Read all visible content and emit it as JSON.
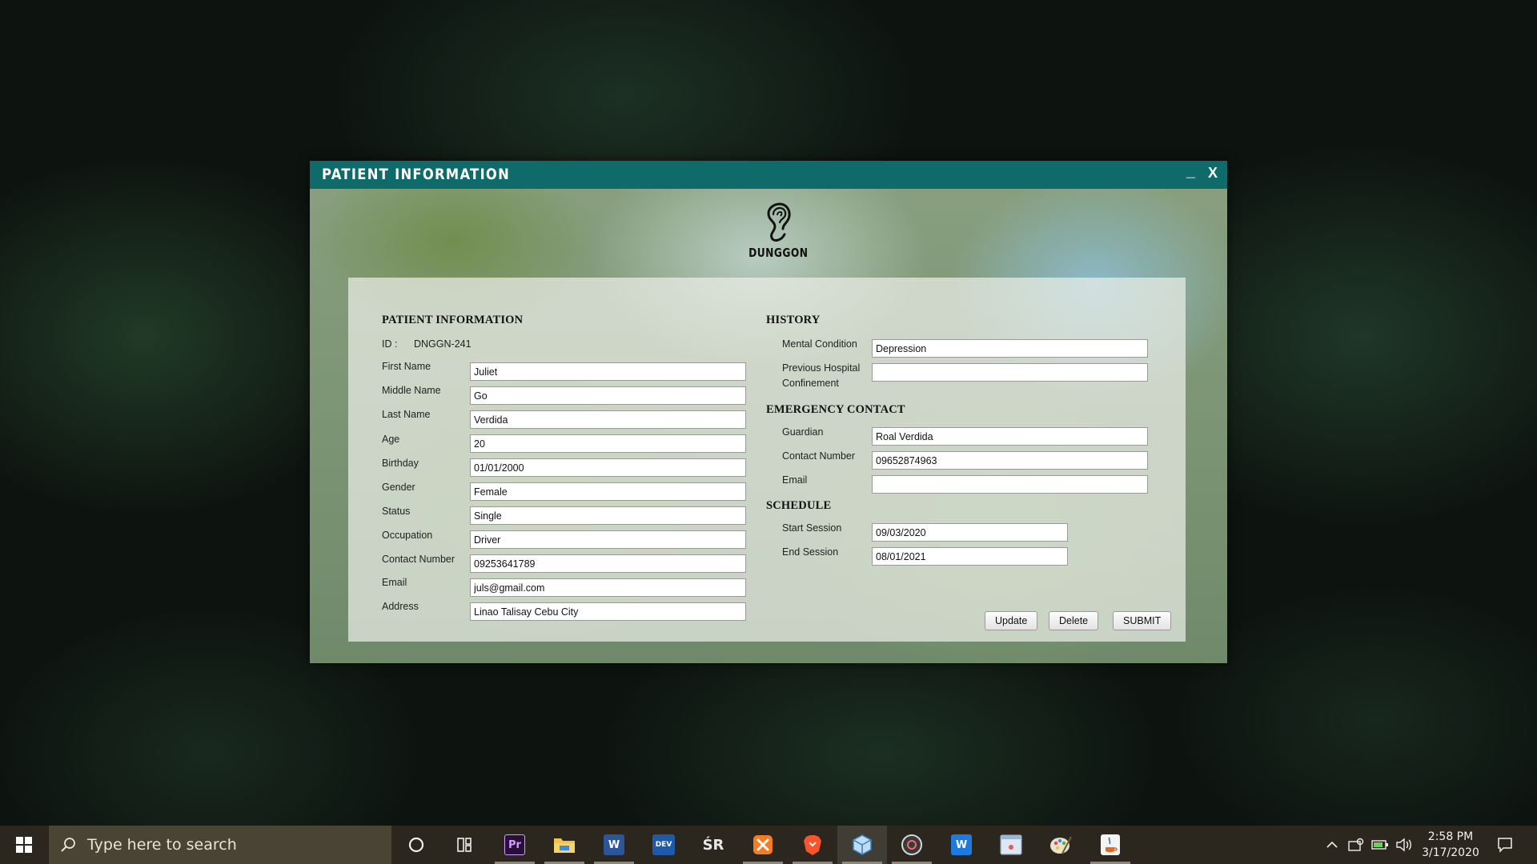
{
  "window": {
    "title": "PATIENT INFORMATION",
    "minimize_label": "_",
    "close_label": "X",
    "logo_text": "DUNGGON",
    "titlebar_color": "#0f6a6a"
  },
  "patient": {
    "section_title": "PATIENT INFORMATION",
    "id_label": "ID :",
    "id_value": "DNGGN-241",
    "fields": [
      {
        "label": "First Name",
        "value": "Juliet"
      },
      {
        "label": "Middle Name",
        "value": "Go"
      },
      {
        "label": "Last Name",
        "value": "Verdida"
      },
      {
        "label": "Age",
        "value": "20"
      },
      {
        "label": "Birthday",
        "value": "01/01/2000"
      },
      {
        "label": "Gender",
        "value": "Female"
      },
      {
        "label": "Status",
        "value": "Single"
      },
      {
        "label": "Occupation",
        "value": "Driver"
      },
      {
        "label": "Contact Number",
        "value": "09253641789"
      },
      {
        "label": "Email",
        "value": "juls@gmail.com"
      },
      {
        "label": "Address",
        "value": "Linao Talisay Cebu City"
      }
    ]
  },
  "history": {
    "section_title": "HISTORY",
    "mental_condition_label": "Mental Condition",
    "mental_condition_value": "Depression",
    "previous_hospital_label_1": "Previous Hospital",
    "previous_hospital_label_2": "Confinement",
    "previous_hospital_value": ""
  },
  "emergency": {
    "section_title": "EMERGENCY CONTACT",
    "guardian_label": "Guardian",
    "guardian_value": "Roal Verdida",
    "contact_label": "Contact Number",
    "contact_value": "09652874963",
    "email_label": "Email",
    "email_value": ""
  },
  "schedule": {
    "section_title": "SCHEDULE",
    "start_label": "Start Session",
    "start_value": "09/03/2020",
    "end_label": "End Session",
    "end_value": "08/01/2021"
  },
  "actions": {
    "update_label": "Update",
    "delete_label": "Delete",
    "submit_label": "SUBMIT"
  },
  "taskbar": {
    "search_placeholder": "Type here to search",
    "time": "2:58 PM",
    "date": "3/17/2020",
    "apps": [
      {
        "icon": "cortana-icon"
      },
      {
        "icon": "task-view-icon"
      },
      {
        "icon": "premiere-pro-icon",
        "text": "Pr",
        "color": "#2a0f3a"
      },
      {
        "icon": "file-explorer-icon"
      },
      {
        "icon": "word-icon",
        "text": "W",
        "color": "#2b579a"
      },
      {
        "icon": "devc-icon",
        "text": "DEV",
        "color": "#1e5aa8"
      },
      {
        "icon": "sr-app-icon",
        "text": "ŚR"
      },
      {
        "icon": "xampp-icon",
        "color": "#f57c20"
      },
      {
        "icon": "brave-icon",
        "color": "#fb542b"
      },
      {
        "icon": "virtualbox-icon",
        "color": "#7fb3e0"
      },
      {
        "icon": "media-player-icon"
      },
      {
        "icon": "wps-writer-icon",
        "text": "W",
        "color": "#1f7ae0"
      },
      {
        "icon": "window-app-icon"
      },
      {
        "icon": "paint-icon"
      },
      {
        "icon": "java-icon"
      }
    ]
  }
}
